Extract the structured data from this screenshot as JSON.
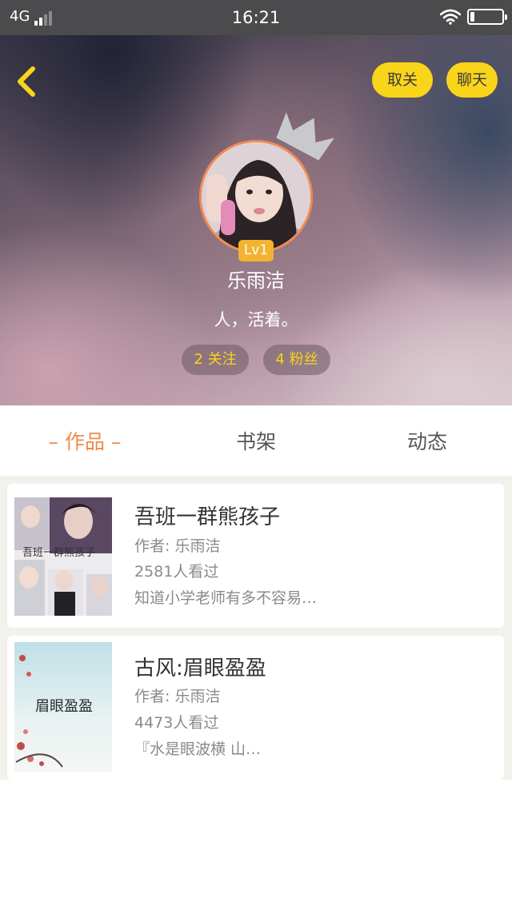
{
  "status_bar": {
    "network": "4G",
    "time": "16:21",
    "icons": [
      "signal-icon",
      "wifi-icon",
      "battery-icon"
    ],
    "battery_level": 0.12
  },
  "header": {
    "back_icon": "chevron-left-icon",
    "unfollow_label": "取关",
    "chat_label": "聊天",
    "crown_icon": "crown-icon",
    "level": "Lv1",
    "username": "乐雨洁",
    "bio": "人，活着。",
    "following_label": "2 关注",
    "fans_label": "4 粉丝"
  },
  "tabs": [
    {
      "label": "作品",
      "active": true
    },
    {
      "label": "书架",
      "active": false
    },
    {
      "label": "动态",
      "active": false
    }
  ],
  "books": [
    {
      "title": "吾班一群熊孩子",
      "author": "作者: 乐雨洁",
      "views": "2581人看过",
      "description": "知道小学老师有多不容易…",
      "cover_text": "吾班一群熊孩子"
    },
    {
      "title": "古风:眉眼盈盈",
      "author": "作者: 乐雨洁",
      "views": "4473人看过",
      "description": "『水是眼波横 山…",
      "cover_text": "眉眼盈盈"
    }
  ],
  "colors": {
    "accent_yellow": "#f8d51b",
    "active_tab": "#ef8a4a",
    "level_badge": "#f3b32f",
    "status_bar": "#4b4b4d"
  }
}
